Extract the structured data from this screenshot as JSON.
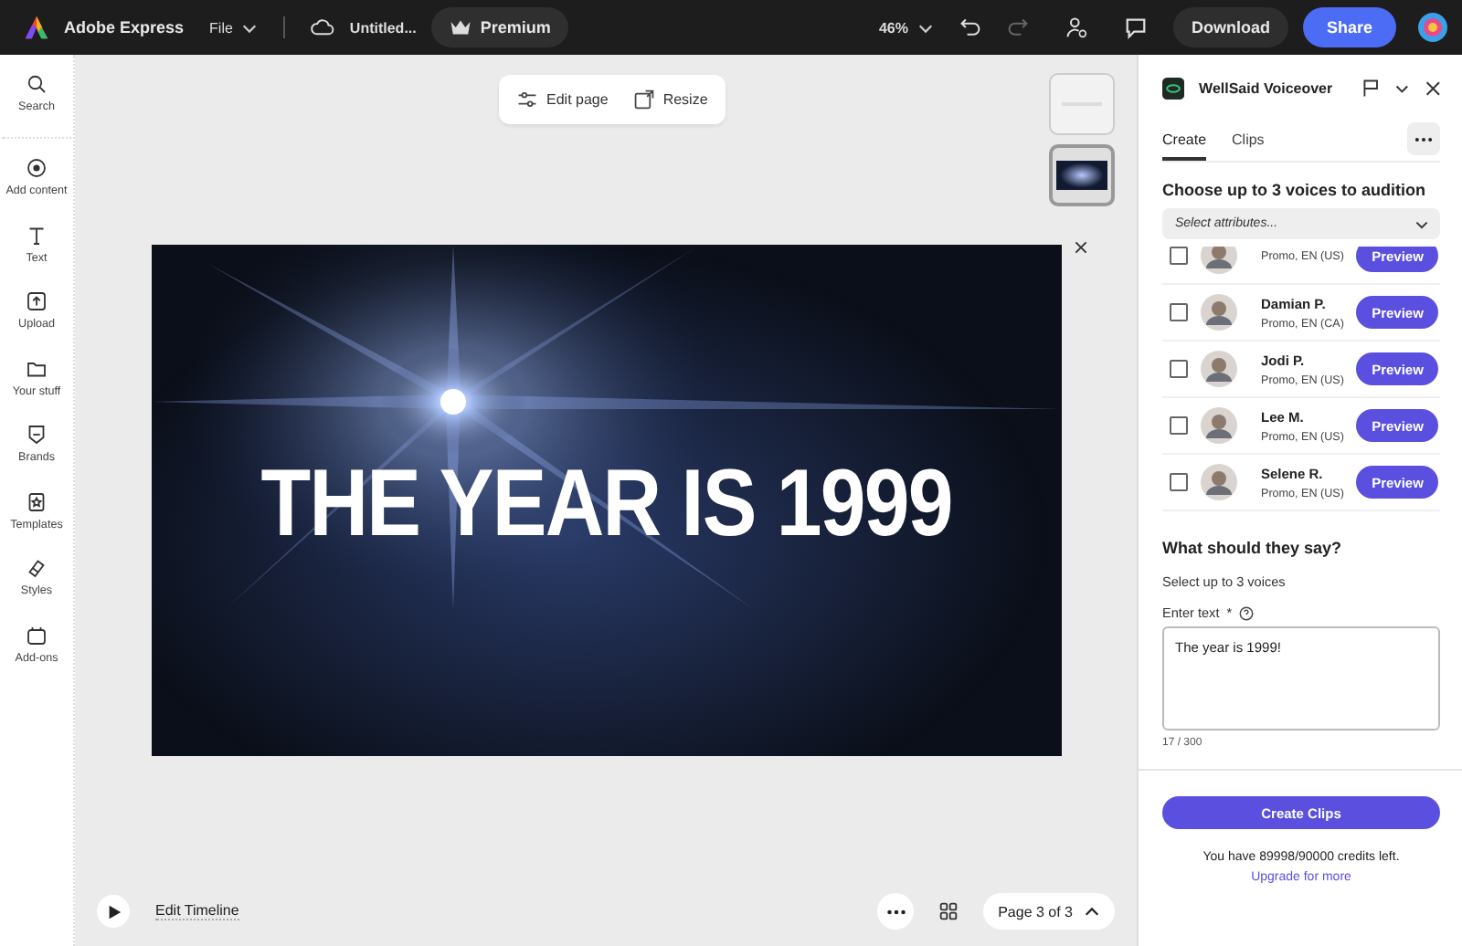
{
  "app_bar": {
    "app_name": "Adobe Express",
    "file_menu": "File",
    "doc_title": "Untitled...",
    "premium": "Premium",
    "zoom": "46%",
    "history": [
      {
        "kind": "undo",
        "disabled": false
      },
      {
        "kind": "redo",
        "disabled": true
      }
    ],
    "download": "Download",
    "share": "Share"
  },
  "rail": [
    {
      "kind": "search",
      "label": "Search"
    },
    {
      "kind": "add",
      "label": "Add content"
    },
    {
      "kind": "text",
      "label": "Text"
    },
    {
      "kind": "upload",
      "label": "Upload"
    },
    {
      "kind": "folder",
      "label": "Your stuff"
    },
    {
      "kind": "brand",
      "label": "Brands"
    },
    {
      "kind": "template",
      "label": "Templates"
    },
    {
      "kind": "styles",
      "label": "Styles"
    },
    {
      "kind": "addons",
      "label": "Add-ons"
    }
  ],
  "canvas": {
    "toolbar": [
      {
        "kind": "edit",
        "label": "Edit page"
      },
      {
        "kind": "resize",
        "label": "Resize"
      }
    ],
    "pages": [
      {
        "kind": "light",
        "selected": false
      },
      {
        "kind": "dark",
        "selected": true
      }
    ],
    "headline": "THE YEAR IS 1999",
    "edit_timeline": "Edit Timeline",
    "page_indicator": "Page 3 of 3"
  },
  "panel": {
    "title": "WellSaid Voiceover",
    "tabs": [
      {
        "label": "Create",
        "selected": true
      },
      {
        "label": "Clips",
        "selected": false
      }
    ],
    "heading": "Choose up to 3 voices to audition",
    "select_placeholder": "Select attributes...",
    "voices": [
      {
        "meta": "Promo, EN (US)",
        "checked": false,
        "button": "Preview"
      },
      {
        "name": "Damian P.",
        "meta": "Promo, EN (CA)",
        "checked": false,
        "button": "Preview"
      },
      {
        "name": "Jodi P.",
        "meta": "Promo, EN (US)",
        "checked": false,
        "button": "Preview"
      },
      {
        "name": "Lee M.",
        "meta": "Promo, EN (US)",
        "checked": false,
        "button": "Preview"
      },
      {
        "name": "Selene R.",
        "meta": "Promo, EN (US)",
        "checked": false,
        "button": "Preview"
      }
    ],
    "say_heading": "What should they say?",
    "hint": "Select up to 3 voices",
    "text_label": "Enter text",
    "required": "*",
    "text_value": "The year is 1999!",
    "counter": "17 / 300",
    "create": "Create Clips",
    "credits": "You have 89998/90000 credits left.",
    "upgrade": "Upgrade for more"
  }
}
